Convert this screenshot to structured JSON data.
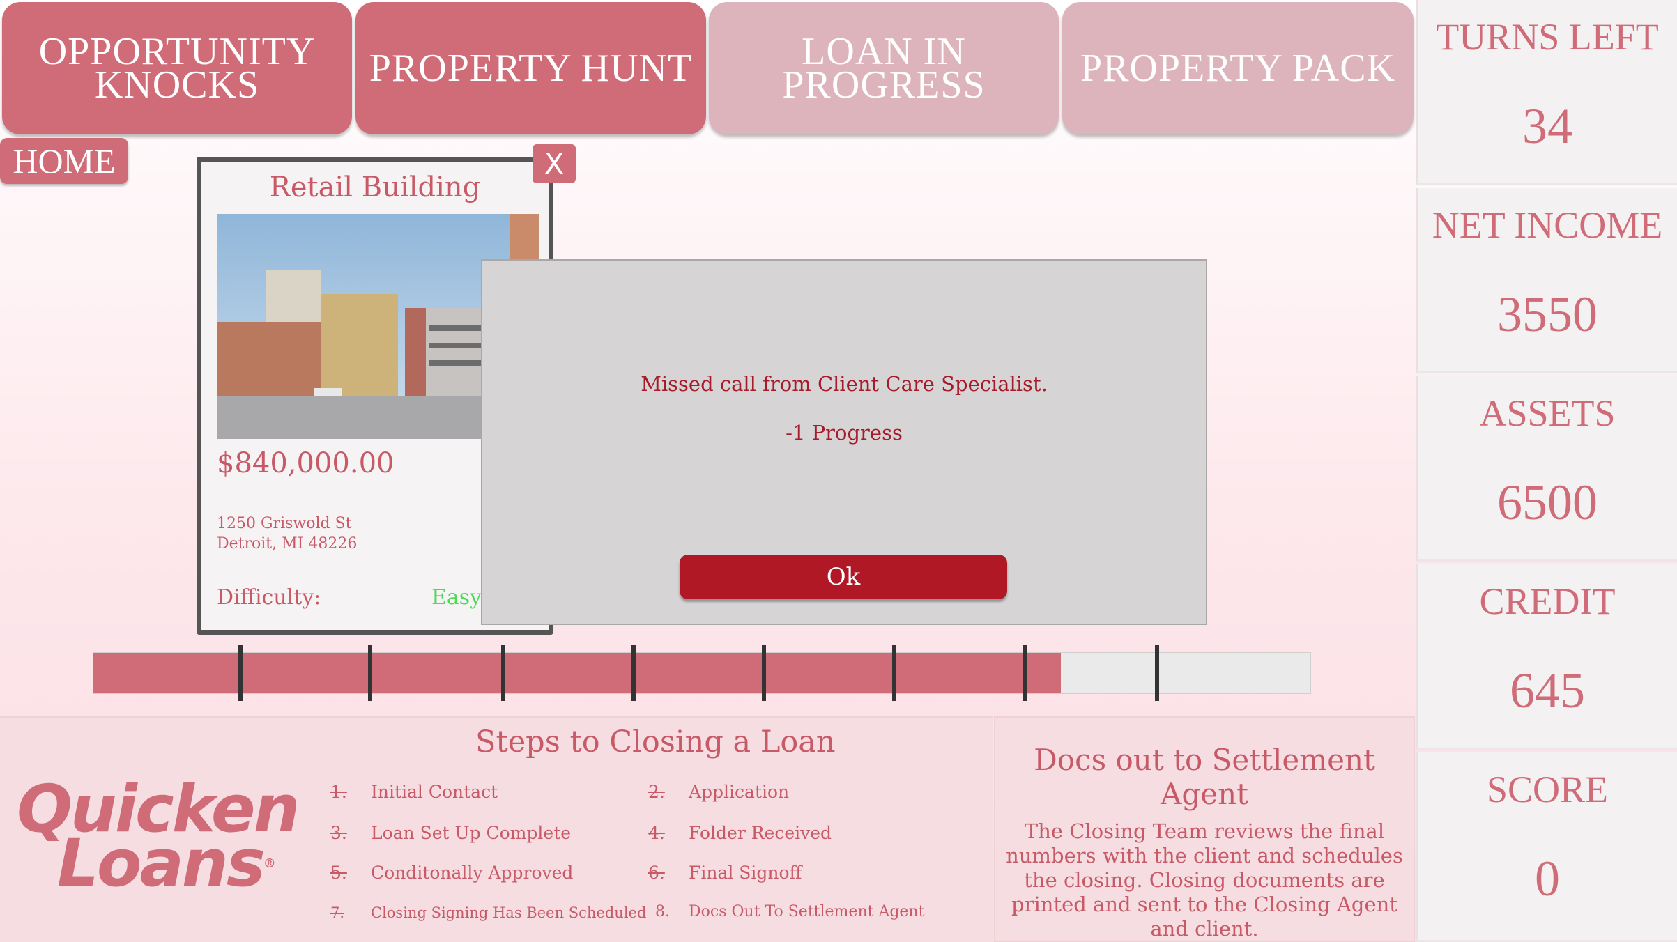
{
  "nav": {
    "opportunity": "OPPORTUNITY\nKNOCKS",
    "property_hunt": "PROPERTY HUNT",
    "loan_in_progress": "LOAN IN\nPROGRESS",
    "property_pack": "PROPERTY PACK"
  },
  "stats": [
    {
      "label": "TURNS LEFT",
      "value": "34"
    },
    {
      "label": "NET INCOME",
      "value": "3550"
    },
    {
      "label": "ASSETS",
      "value": "6500"
    },
    {
      "label": "CREDIT",
      "value": "645"
    },
    {
      "label": "SCORE",
      "value": "0"
    }
  ],
  "home_label": "HOME",
  "close_label": "X",
  "property": {
    "title": "Retail Building",
    "price": "$840,000.00",
    "address_line1": "1250 Griswold St",
    "address_line2": "Detroit, MI 48226",
    "difficulty_label": "Difficulty:",
    "difficulty_value": "Easy"
  },
  "dialog": {
    "message": "Missed call from Client Care Specialist.",
    "detail": "-1 Progress",
    "ok_label": "Ok"
  },
  "progress": {
    "fraction": 0.795,
    "segments": 9,
    "colors": {
      "fill": "#d06b78",
      "empty": "#eaeaea"
    }
  },
  "steps": {
    "title": "Steps to Closing a Loan",
    "items": [
      {
        "num": "1.",
        "label": "Initial Contact",
        "done": true
      },
      {
        "num": "2.",
        "label": "Application",
        "done": true
      },
      {
        "num": "3.",
        "label": "Loan Set Up Complete",
        "done": true
      },
      {
        "num": "4.",
        "label": "Folder Received",
        "done": true
      },
      {
        "num": "5.",
        "label": "Conditonally Approved",
        "done": true
      },
      {
        "num": "6.",
        "label": "Final Signoff",
        "done": true
      },
      {
        "num": "7.",
        "label": "Closing Signing Has Been Scheduled",
        "done": true
      },
      {
        "num": "8.",
        "label": "Docs Out To Settlement Agent",
        "done": false
      }
    ]
  },
  "logo": {
    "line1": "Quicken",
    "line2": "Loans",
    "mark": "®"
  },
  "current_step": {
    "title": "Docs out to Settlement Agent",
    "description": "The Closing Team reviews the final numbers with the client and schedules the closing. Closing documents are printed and sent to the Closing Agent and client."
  },
  "colors": {
    "accent": "#d06b78",
    "dialog_text": "#a61b29",
    "ok_button": "#b01826",
    "easy": "#4dda56"
  }
}
